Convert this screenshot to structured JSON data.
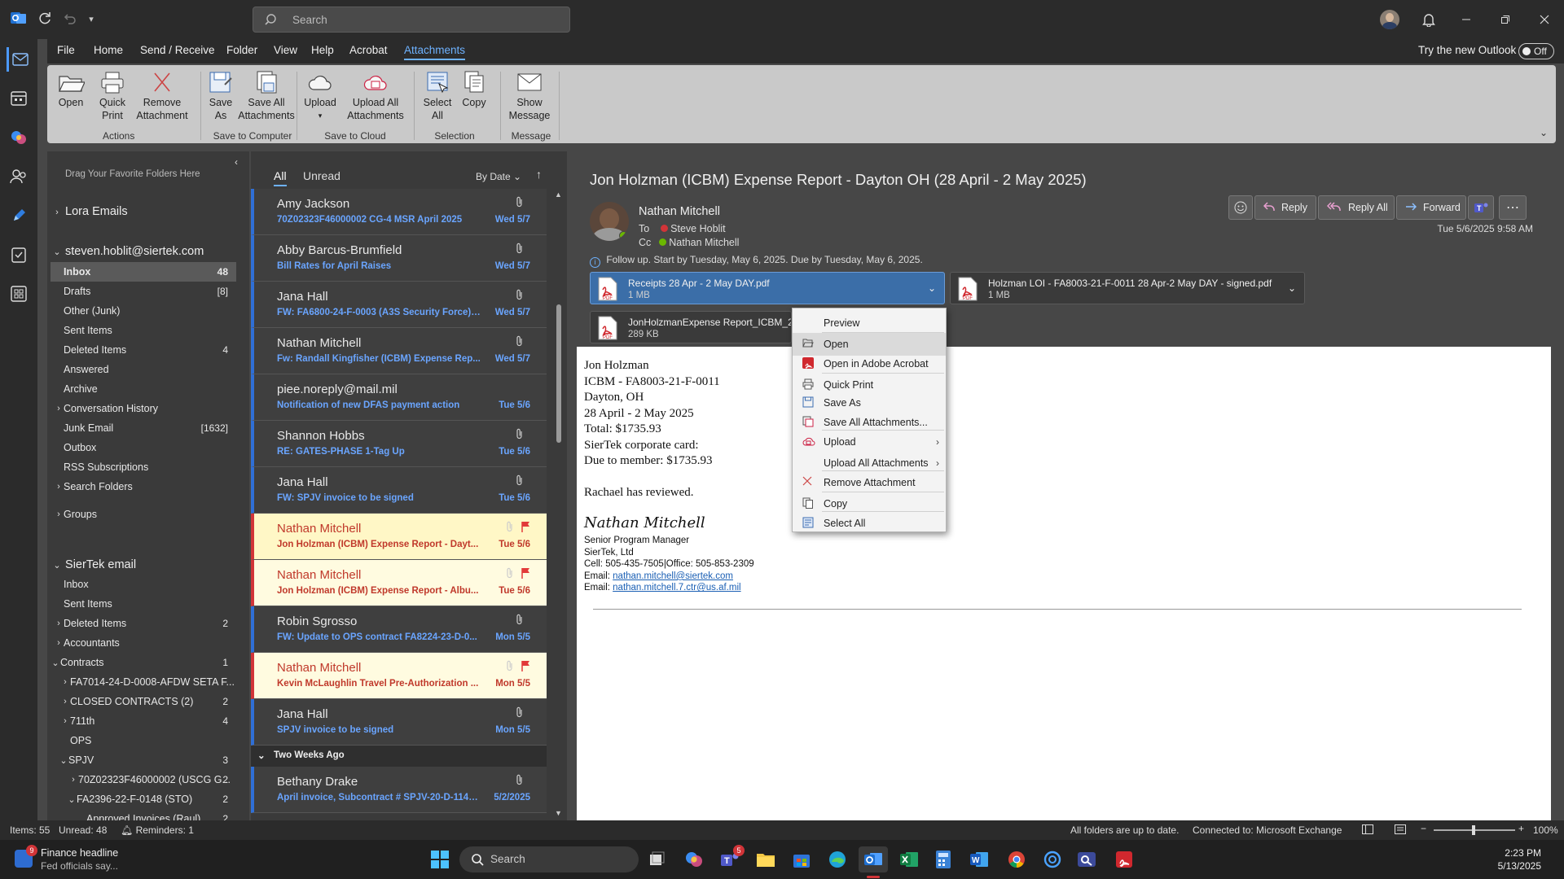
{
  "titlebar": {
    "search_placeholder": "Search"
  },
  "ribbon_tabs": [
    "File",
    "Home",
    "Send / Receive",
    "Folder",
    "View",
    "Help",
    "Acrobat",
    "Attachments"
  ],
  "try_new_outlook": {
    "label": "Try the new Outlook",
    "toggle": "Off"
  },
  "ribbon": {
    "open": "Open",
    "quick_print": "Quick\nPrint",
    "remove": "Remove\nAttachment",
    "actions_label": "Actions",
    "save_as": "Save\nAs",
    "save_all": "Save All\nAttachments",
    "save_computer_label": "Save to Computer",
    "upload": "Upload",
    "upload_all": "Upload All\nAttachments",
    "save_cloud_label": "Save to Cloud",
    "select_all": "Select\nAll",
    "copy": "Copy",
    "selection_label": "Selection",
    "show_message": "Show\nMessage",
    "message_label": "Message"
  },
  "folder_pane": {
    "favorites_hint": "Drag Your Favorite Folders Here",
    "groups": [
      {
        "label": "Lora Emails"
      },
      {
        "label": "steven.hoblit@siertek.com"
      }
    ],
    "folders": [
      {
        "label": "Inbox",
        "count": "48"
      },
      {
        "label": "Drafts",
        "count": "[8]"
      },
      {
        "label": "Other (Junk)",
        "count": ""
      },
      {
        "label": "Sent Items",
        "count": ""
      },
      {
        "label": "Deleted Items",
        "count": "4"
      },
      {
        "label": "Answered",
        "count": ""
      },
      {
        "label": "Archive",
        "count": ""
      },
      {
        "label": "Conversation History",
        "count": ""
      },
      {
        "label": "Junk Email",
        "count": "[1632]"
      },
      {
        "label": "Outbox",
        "count": ""
      },
      {
        "label": "RSS Subscriptions",
        "count": ""
      },
      {
        "label": "Search Folders",
        "count": ""
      },
      {
        "label": "Groups",
        "count": ""
      }
    ],
    "siertek_group": "SierTek email",
    "siertek_folders": [
      {
        "label": "Inbox",
        "count": ""
      },
      {
        "label": "Sent Items",
        "count": ""
      },
      {
        "label": "Deleted Items",
        "count": "2"
      },
      {
        "label": "Accountants",
        "count": ""
      },
      {
        "label": "Contracts",
        "count": "1"
      },
      {
        "label": "FA7014-24-D-0008-AFDW SETA F...",
        "count": ""
      },
      {
        "label": "CLOSED CONTRACTS (2)",
        "count": "2"
      },
      {
        "label": "711th",
        "count": "4"
      },
      {
        "label": "OPS",
        "count": ""
      },
      {
        "label": "SPJV",
        "count": "3"
      },
      {
        "label": "70Z02323F46000002 (USCG G...",
        "count": "2"
      },
      {
        "label": "FA2396-22-F-0148 (STO)",
        "count": "2"
      },
      {
        "label": "Approved Invoices (Raul)",
        "count": "2"
      }
    ]
  },
  "msg_list": {
    "tab_all": "All",
    "tab_unread": "Unread",
    "sort": "By Date",
    "messages": [
      {
        "from": "Amy Jackson",
        "subject": "70Z02323F46000002  CG-4  MSR April 2025",
        "date": "Wed 5/7"
      },
      {
        "from": "Abby Barcus-Brumfield",
        "subject": "Bill Rates for April Raises",
        "date": "Wed 5/7"
      },
      {
        "from": "Jana Hall",
        "subject": "FW: FA6800-24-F-0003 (A3S Security Force) ...",
        "date": "Wed 5/7"
      },
      {
        "from": "Nathan Mitchell",
        "subject": "Fw: Randall Kingfisher (ICBM) Expense Rep...",
        "date": "Wed 5/7"
      },
      {
        "from": "piee.noreply@mail.mil",
        "subject": "Notification of new DFAS payment action",
        "date": "Tue 5/6"
      },
      {
        "from": "Shannon Hobbs",
        "subject": "RE: GATES-PHASE 1-Tag Up",
        "date": "Tue 5/6"
      },
      {
        "from": "Jana Hall",
        "subject": "FW: SPJV invoice to be signed",
        "date": "Tue 5/6"
      },
      {
        "from": "Nathan Mitchell",
        "subject": "Jon Holzman (ICBM) Expense Report - Dayt...",
        "date": "Tue 5/6"
      },
      {
        "from": "Nathan Mitchell",
        "subject": "Jon Holzman (ICBM) Expense Report - Albu...",
        "date": "Tue 5/6"
      },
      {
        "from": "Robin Sgrosso",
        "subject": "FW: Update to OPS contract FA8224-23-D-0...",
        "date": "Mon 5/5"
      },
      {
        "from": "Nathan Mitchell",
        "subject": "Kevin McLaughlin Travel Pre-Authorization ...",
        "date": "Mon 5/5"
      },
      {
        "from": "Jana Hall",
        "subject": "SPJV invoice to be signed",
        "date": "Mon 5/5"
      }
    ],
    "section": "Two Weeks Ago",
    "older": [
      {
        "from": "Bethany Drake",
        "subject": "April invoice, Subcontract # SPJV-20-D-1146...",
        "date": "5/2/2025"
      }
    ]
  },
  "reading": {
    "subject": "Jon Holzman (ICBM) Expense Report - Dayton OH (28 April - 2 May 2025)",
    "sender": "Nathan Mitchell",
    "to_label": "To",
    "to": "Steve Hoblit",
    "cc_label": "Cc",
    "cc": "Nathan Mitchell",
    "date": "Tue 5/6/2025 9:58 AM",
    "followup": "Follow up.  Start by Tuesday, May 6, 2025.  Due by Tuesday, May 6, 2025.",
    "actions": {
      "reply": "Reply",
      "reply_all": "Reply All",
      "forward": "Forward"
    },
    "attachments": [
      {
        "name": "Receipts 28 Apr - 2 May DAY.pdf",
        "size": "1 MB"
      },
      {
        "name": "Holzman LOI - FA8003-21-F-0011 28 Apr-2 May DAY - signed.pdf",
        "size": "1 MB"
      },
      {
        "name": "JonHolzmanExpense Report_ICBM_28A",
        "size": "289 KB"
      }
    ],
    "body_lines": [
      "Jon Holzman",
      "ICBM - FA8003-21-F-0011",
      "Dayton, OH",
      "28 April - 2 May 2025",
      "Total: $1735.93",
      "SierTek corporate card:",
      "Due to member: $1735.93",
      "",
      "Rachael has reviewed."
    ],
    "signature_script": "Nathan Mitchell",
    "sig_lines": [
      "Senior Program Manager",
      "SierTek, Ltd",
      "Cell: 505-435-7505|Office: 505-853-2309"
    ],
    "email_label": "Email: ",
    "email1": "nathan.mitchell@siertek.com",
    "email2": "nathan.mitchell.7.ctr@us.af.mil"
  },
  "context_menu": [
    {
      "label": "Preview",
      "icon": ""
    },
    {
      "label": "Open",
      "icon": "folder-open-icon"
    },
    {
      "label": "Open in Adobe Acrobat",
      "icon": "acrobat-icon"
    },
    {
      "label": "Quick Print",
      "icon": "printer-icon"
    },
    {
      "label": "Save As",
      "icon": "save-icon"
    },
    {
      "label": "Save All Attachments...",
      "icon": "save-all-icon"
    },
    {
      "label": "Upload",
      "icon": "cloud-upload-icon"
    },
    {
      "label": "Upload All Attachments",
      "icon": ""
    },
    {
      "label": "Remove Attachment",
      "icon": "x-icon"
    },
    {
      "label": "Copy",
      "icon": "copy-icon"
    },
    {
      "label": "Select All",
      "icon": "select-all-icon"
    }
  ],
  "status": {
    "items": "Items: 55",
    "unread": "Unread: 48",
    "reminders": "Reminders: 1",
    "sync": "All folders are up to date.",
    "connected": "Connected to: Microsoft Exchange",
    "zoom": "100%"
  },
  "taskbar": {
    "news_title": "Finance headline",
    "news_sub": "Fed officials say...",
    "news_badge": "9",
    "search": "Search",
    "teams_badge": "5",
    "time": "2:23 PM",
    "date": "5/13/2025"
  },
  "colors": {
    "accent": "#2f6fd6",
    "flag": "#e23a3a",
    "link": "#1a5fb4"
  }
}
